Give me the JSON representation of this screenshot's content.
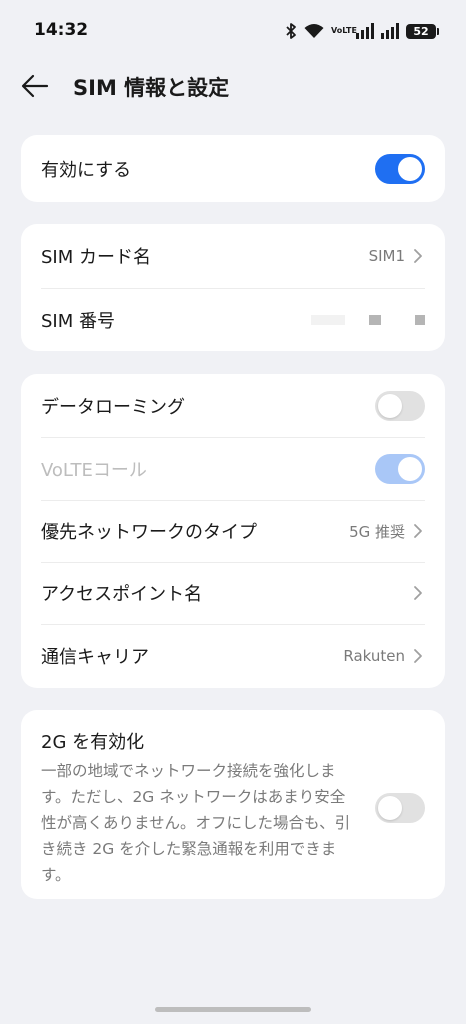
{
  "status_bar": {
    "time": "14:32",
    "volte_top": "Vo",
    "volte_bottom": "LTE",
    "battery": "52"
  },
  "header": {
    "title": "SIM 情報と設定"
  },
  "enable_card": {
    "label": "有効にする",
    "toggle_on": true
  },
  "sim_card": {
    "name_label": "SIM カード名",
    "name_value": "SIM1",
    "number_label": "SIM 番号"
  },
  "network_card": {
    "data_roaming_label": "データローミング",
    "data_roaming_on": false,
    "volte_label": "VoLTEコール",
    "volte_on": true,
    "preferred_network_label": "優先ネットワークのタイプ",
    "preferred_network_value": "5G 推奨",
    "apn_label": "アクセスポイント名",
    "carrier_label": "通信キャリア",
    "carrier_value": "Rakuten"
  },
  "enable_2g_card": {
    "title": "2G を有効化",
    "description": "一部の地域でネットワーク接続を強化します。ただし、2G ネットワークはあまり安全性が高くありません。オフにした場合も、引き続き 2G を介した緊急通報を利用できます。",
    "toggle_on": false
  },
  "colors": {
    "accent": "#1f6ff2",
    "background": "#f0f1f5",
    "card": "#ffffff"
  }
}
